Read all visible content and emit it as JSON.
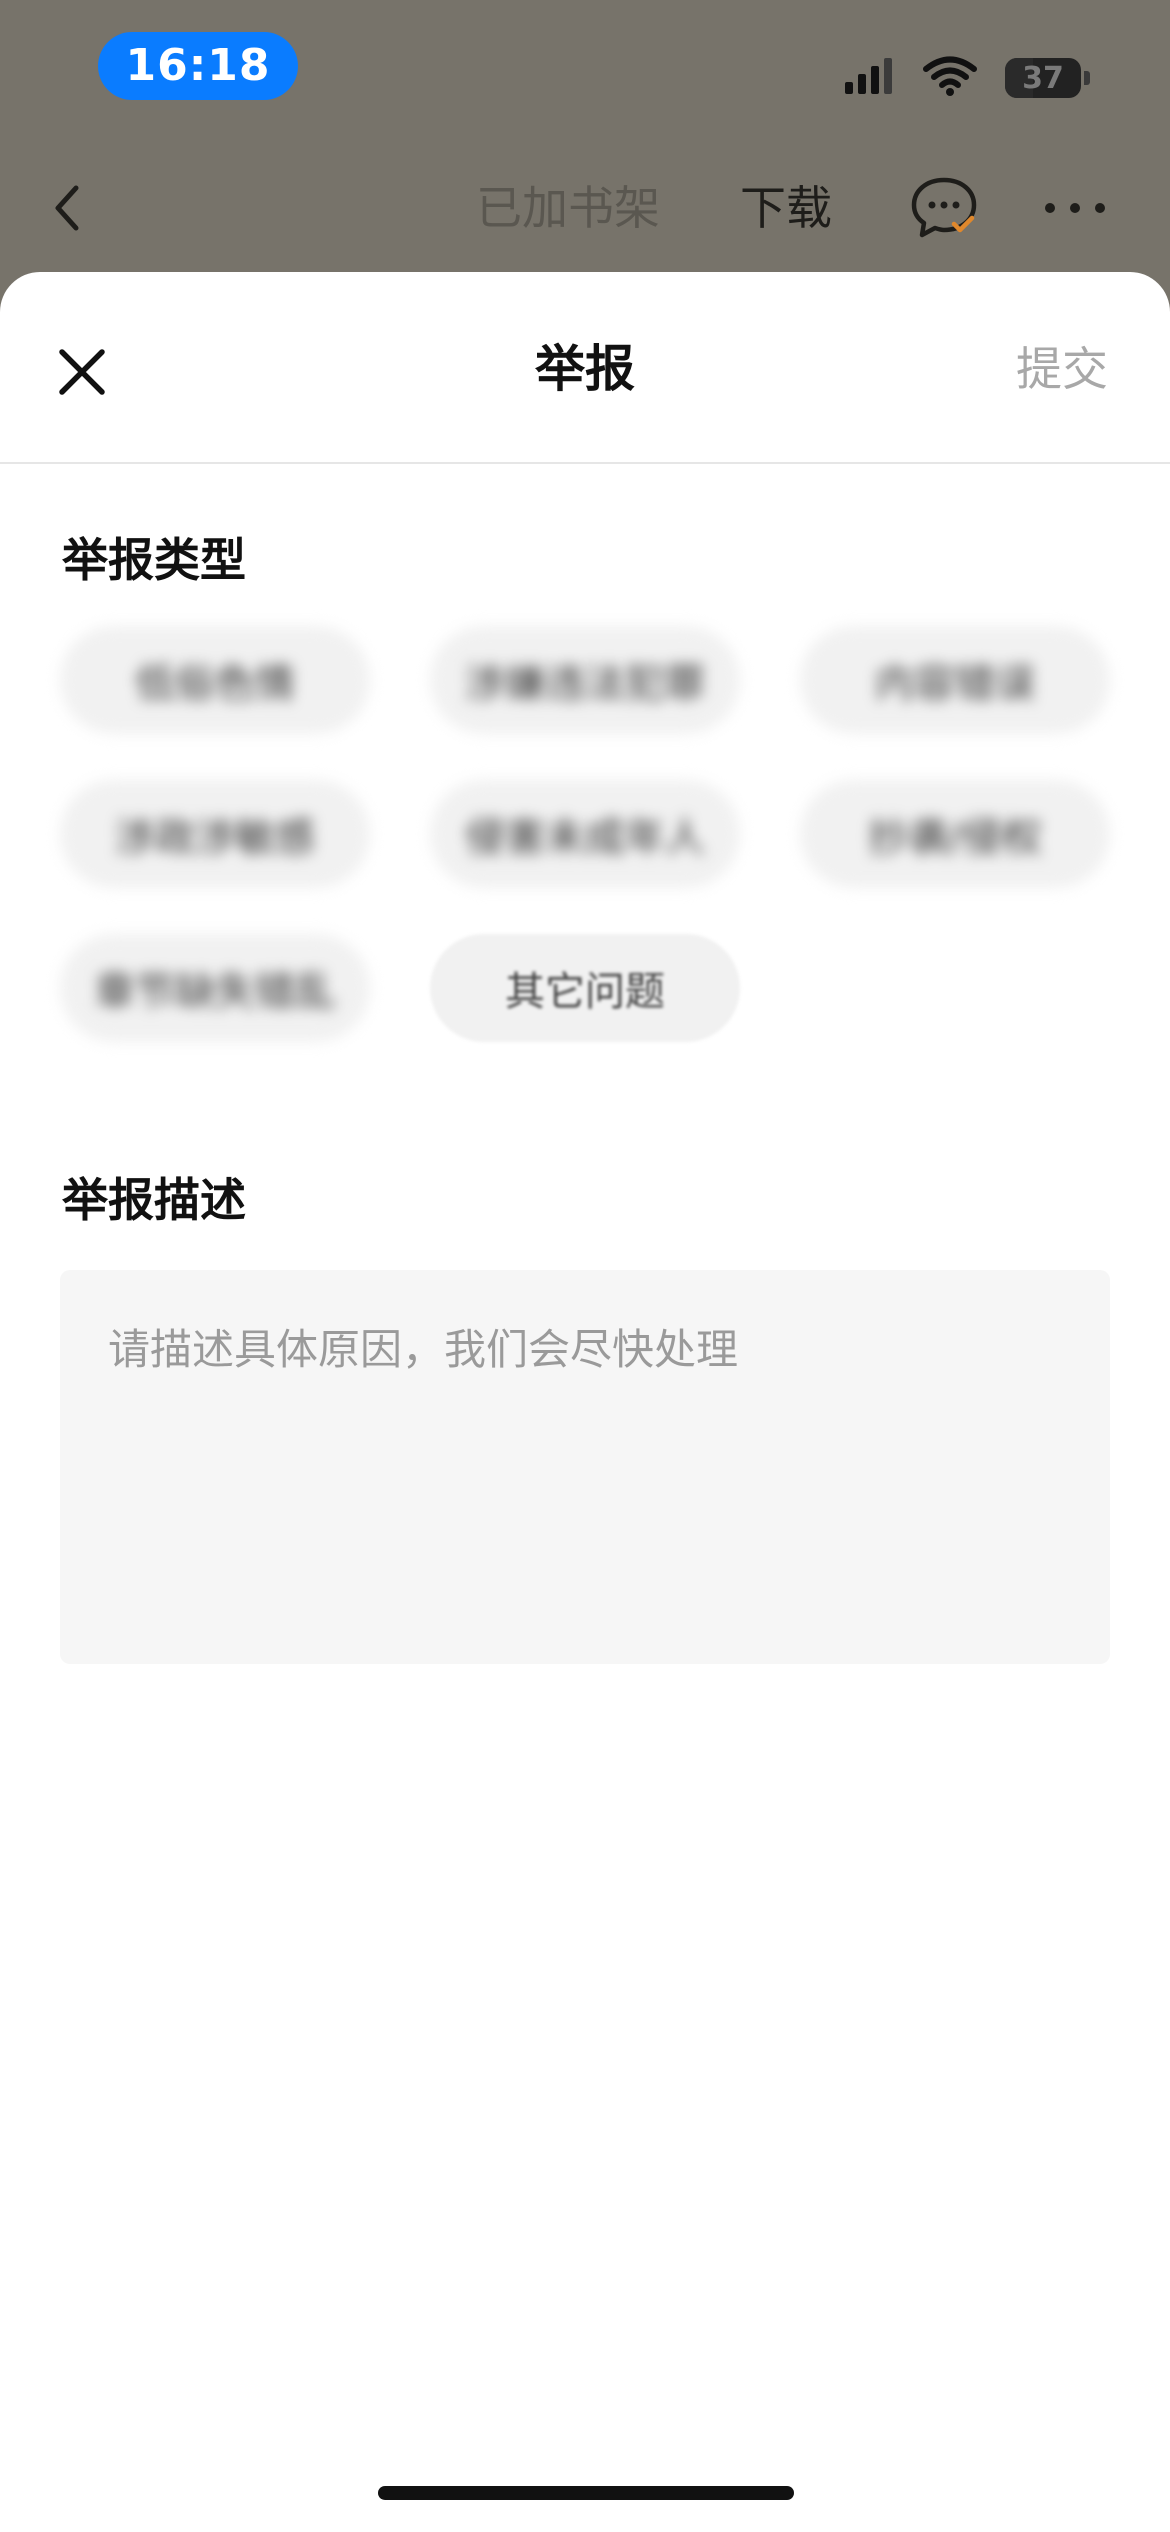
{
  "status_bar": {
    "time": "16:18",
    "battery": "37",
    "icons": [
      "cellular-signal-icon",
      "wifi-icon",
      "battery-icon"
    ]
  },
  "toolbar": {
    "back_icon": "chevron-left-icon",
    "shelf_label": "已加书架",
    "download_label": "下载",
    "chat_icon": "comment-icon",
    "more_icon": "more-dots-icon"
  },
  "sheet": {
    "close_icon": "close-icon",
    "title": "举报",
    "submit_label": "提交"
  },
  "report_type": {
    "label": "举报类型",
    "options": [
      {
        "label": "低俗色情"
      },
      {
        "label": "涉嫌违法犯罪"
      },
      {
        "label": "内容错误"
      },
      {
        "label": "涉政涉敏感"
      },
      {
        "label": "侵害未成年人"
      },
      {
        "label": "抄袭/侵权"
      },
      {
        "label": "章节缺失错乱"
      },
      {
        "label": "其它问题"
      }
    ]
  },
  "report_desc": {
    "label": "举报描述",
    "placeholder": "请描述具体原因，我们会尽快处理",
    "value": ""
  },
  "colors": {
    "overlay_bg": "#77736a",
    "time_pill": "#0a7cff",
    "accent_orange": "#e0882c",
    "submit_disabled": "#a8a8a8"
  }
}
